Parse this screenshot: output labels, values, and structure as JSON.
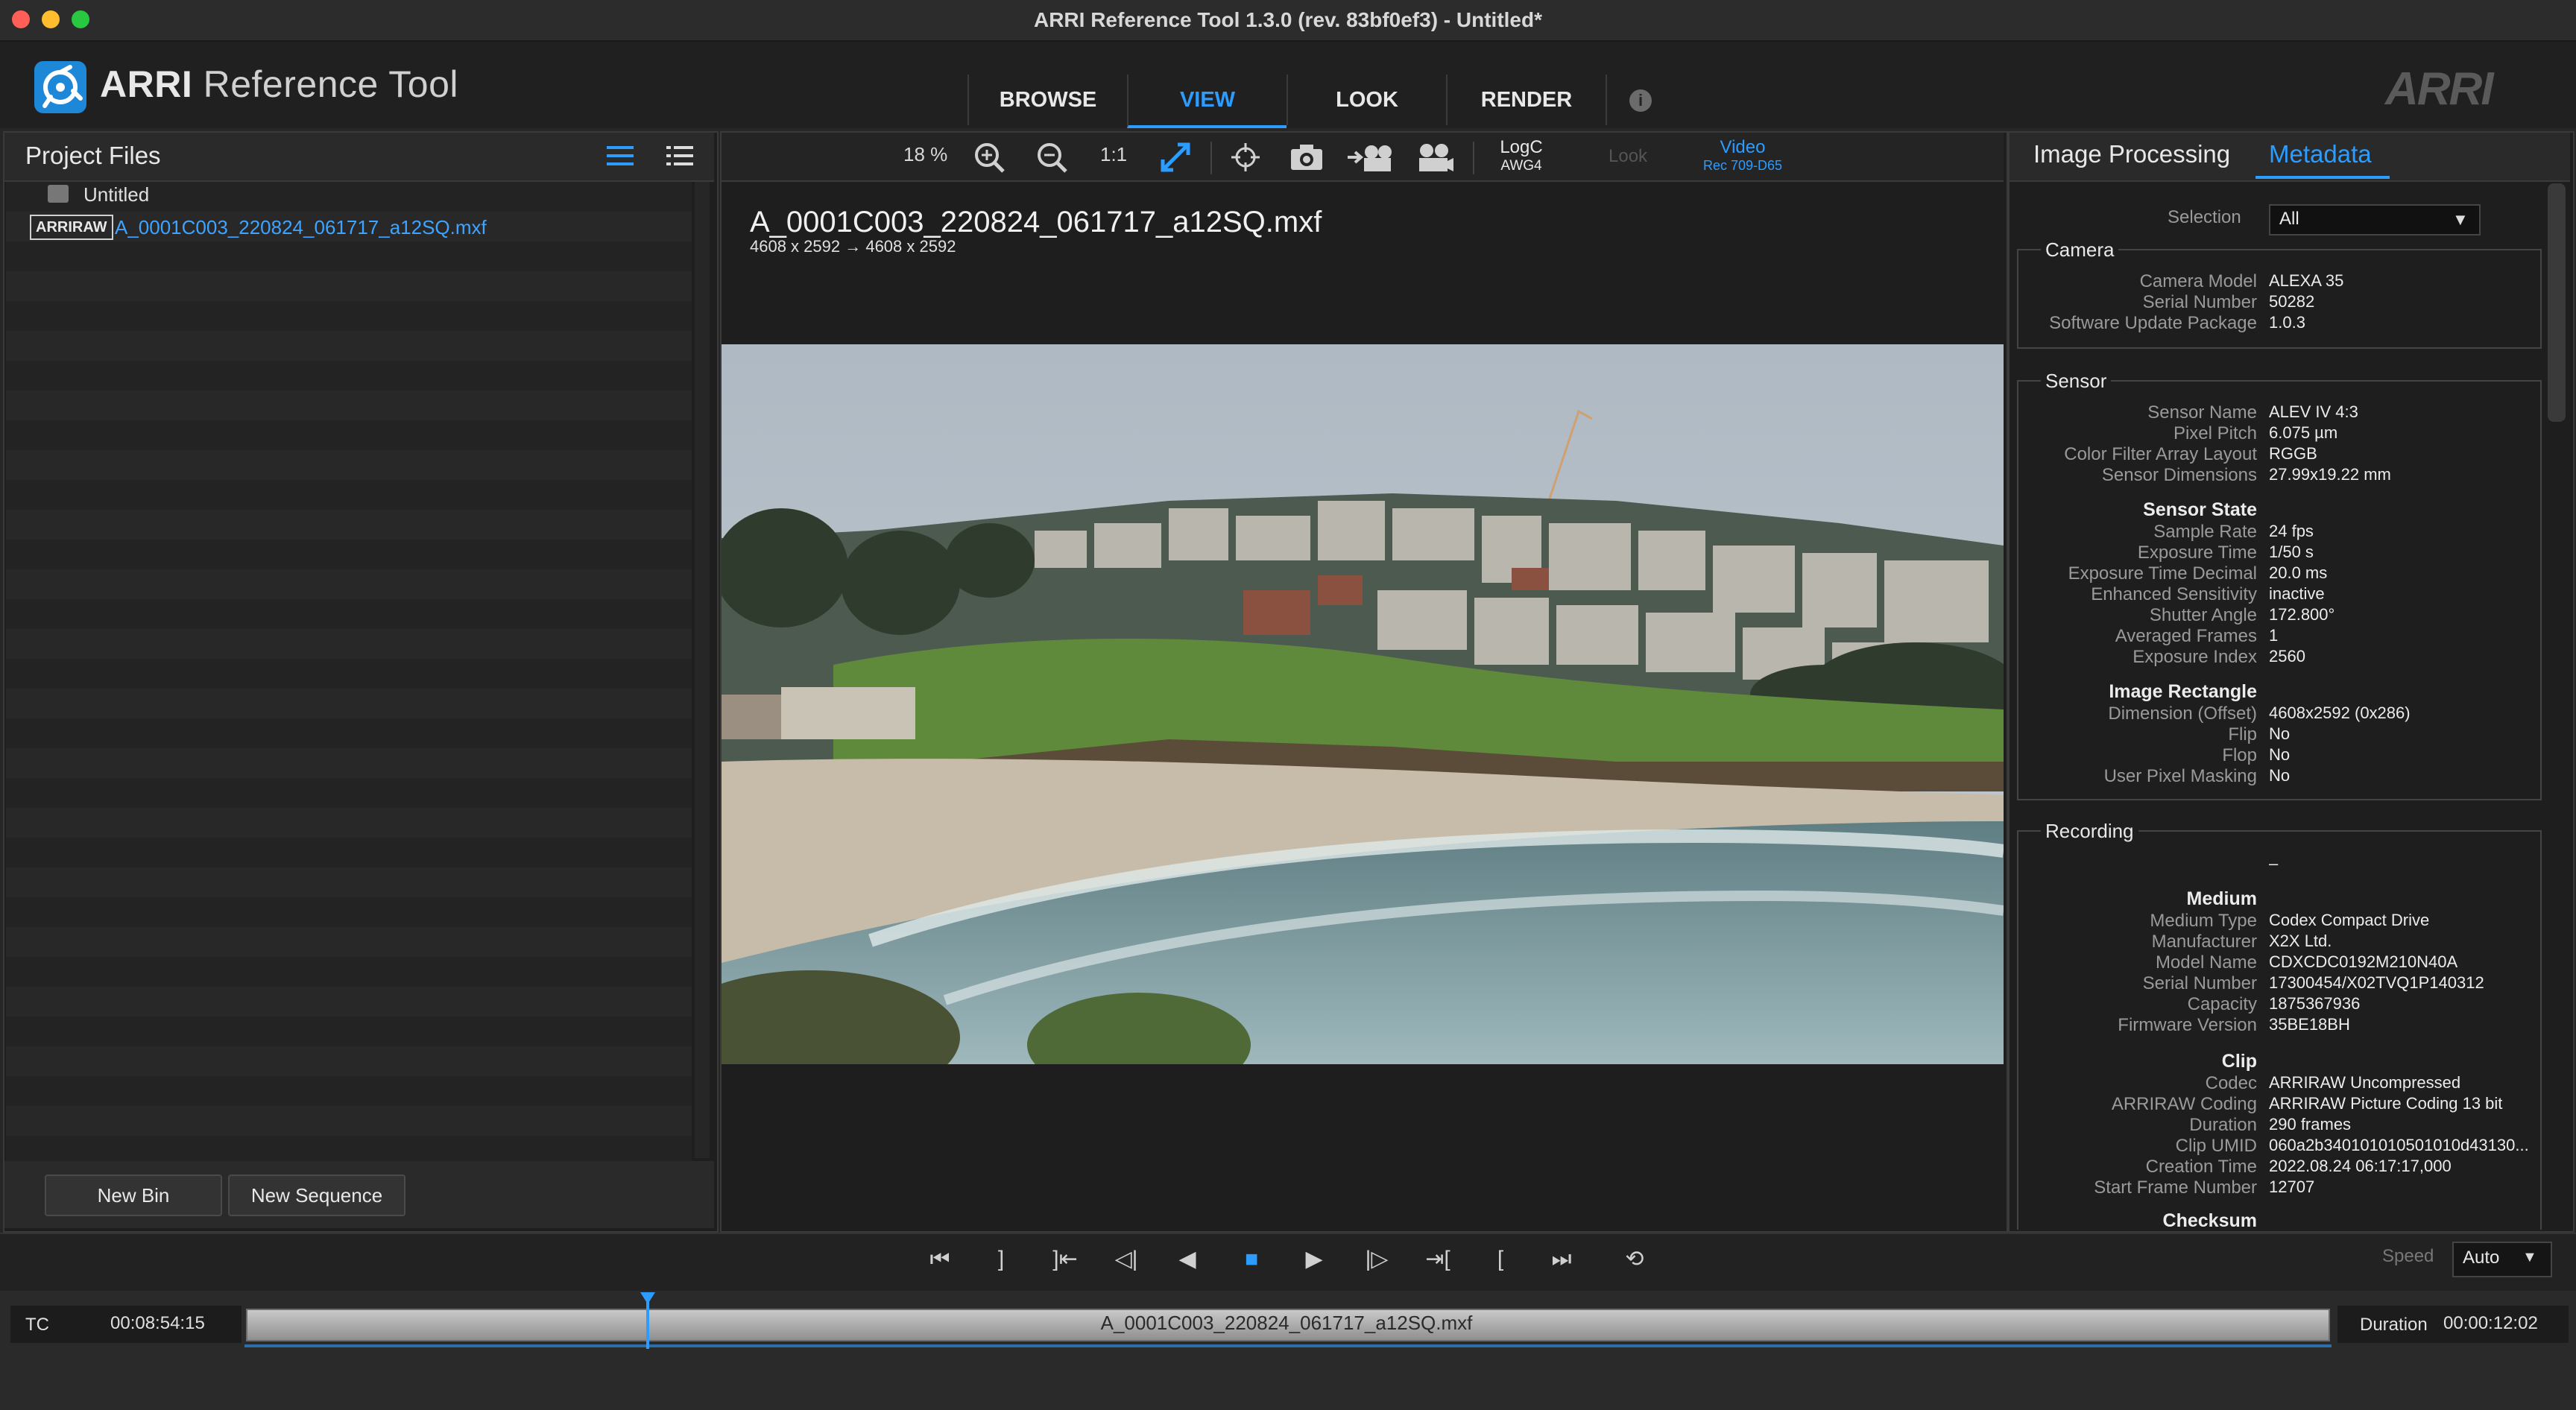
{
  "window": {
    "title": "ARRI Reference Tool 1.3.0 (rev. 83bf0ef3) - Untitled*",
    "traffic_lights": [
      "close",
      "minimize",
      "zoom"
    ]
  },
  "header": {
    "app_name_strong": "ARRI",
    "app_name_light": "Reference Tool",
    "tabs": [
      {
        "label": "BROWSE",
        "active": false
      },
      {
        "label": "VIEW",
        "active": true
      },
      {
        "label": "LOOK",
        "active": false
      },
      {
        "label": "RENDER",
        "active": false
      }
    ],
    "info_icon": "i",
    "brand": "ARRI"
  },
  "project_files": {
    "title": "Project Files",
    "view_icons": [
      "list-view-icon",
      "detail-list-icon"
    ],
    "items": [
      {
        "label": "Untitled",
        "icon": "bin-icon"
      },
      {
        "badge": "ARRIRAW",
        "label": "A_0001C003_220824_061717_a12SQ.mxf"
      }
    ],
    "buttons": {
      "new_bin": "New Bin",
      "new_sequence": "New Sequence"
    }
  },
  "viewer": {
    "zoom": "18 %",
    "one_to_one": "1:1",
    "input_color": {
      "top": "LogC",
      "bottom": "AWG4"
    },
    "look": "Look",
    "output": {
      "top": "Video",
      "bottom": "Rec 709-D65"
    },
    "clip_name": "A_0001C003_220824_061717_a12SQ.mxf",
    "clip_dims": "4608 x 2592  → 4608 x 2592"
  },
  "metadata_panel": {
    "tabs": [
      {
        "label": "Image Processing",
        "active": false
      },
      {
        "label": "Metadata",
        "active": true
      }
    ],
    "selection_label": "Selection",
    "selection_value": "All",
    "camera": {
      "title": "Camera",
      "rows": [
        {
          "k": "Camera Model",
          "v": "ALEXA 35"
        },
        {
          "k": "Serial Number",
          "v": "50282"
        },
        {
          "k": "Software Update Package",
          "v": "1.0.3"
        }
      ]
    },
    "sensor": {
      "title": "Sensor",
      "rows": [
        {
          "k": "Sensor Name",
          "v": "ALEV IV 4:3"
        },
        {
          "k": "Pixel Pitch",
          "v": "6.075 µm"
        },
        {
          "k": "Color Filter Array Layout",
          "v": "RGGB"
        },
        {
          "k": "Sensor Dimensions",
          "v": "27.99x19.22 mm"
        }
      ],
      "state_title": "Sensor State",
      "state_rows": [
        {
          "k": "Sample Rate",
          "v": "24 fps"
        },
        {
          "k": "Exposure Time",
          "v": "1/50 s"
        },
        {
          "k": "Exposure Time Decimal",
          "v": "20.0 ms"
        },
        {
          "k": "Enhanced Sensitivity",
          "v": "inactive"
        },
        {
          "k": "Shutter Angle",
          "v": "172.800°"
        },
        {
          "k": "Averaged Frames",
          "v": "1"
        },
        {
          "k": "Exposure Index",
          "v": "2560"
        }
      ],
      "rect_title": "Image Rectangle",
      "rect_rows": [
        {
          "k": "Dimension (Offset)",
          "v": "4608x2592 (0x286)"
        },
        {
          "k": "Flip",
          "v": "No"
        },
        {
          "k": "Flop",
          "v": "No"
        },
        {
          "k": "User Pixel Masking",
          "v": "No"
        }
      ]
    },
    "recording": {
      "title": "Recording",
      "dash": "–",
      "medium_title": "Medium",
      "medium_rows": [
        {
          "k": "Medium Type",
          "v": "Codex Compact Drive"
        },
        {
          "k": "Manufacturer",
          "v": "X2X Ltd."
        },
        {
          "k": "Model Name",
          "v": "CDXCDC0192M210N40A"
        },
        {
          "k": "Serial Number",
          "v": "17300454/X02TVQ1P140312"
        },
        {
          "k": "Capacity",
          "v": "1875367936"
        },
        {
          "k": "Firmware Version",
          "v": "35BE18BH"
        }
      ],
      "clip_title": "Clip",
      "clip_rows": [
        {
          "k": "Codec",
          "v": "ARRIRAW Uncompressed"
        },
        {
          "k": "ARRIRAW Coding",
          "v": "ARRIRAW Picture Coding 13 bit"
        },
        {
          "k": "Duration",
          "v": "290 frames"
        },
        {
          "k": "Clip UMID",
          "v": "060a2b340101010501010d43130..."
        },
        {
          "k": "Creation Time",
          "v": "2022.08.24 06:17:17,000"
        },
        {
          "k": "Start Frame Number",
          "v": "12707"
        }
      ],
      "checksum_title": "Checksum"
    }
  },
  "transport": {
    "speed_label": "Speed",
    "speed_value": "Auto",
    "buttons": [
      "go-to-start",
      "mark-out",
      "go-to-in",
      "step-back",
      "play-reverse",
      "stop",
      "play",
      "step-forward",
      "go-to-out",
      "mark-in",
      "go-to-end",
      "loop"
    ]
  },
  "timeline": {
    "tc_label": "TC",
    "tc_value": "00:08:54:15",
    "clip_label": "A_0001C003_220824_061717_a12SQ.mxf",
    "playhead_fraction": 0.193,
    "duration_label": "Duration",
    "duration_value": "00:00:12:02"
  },
  "colors": {
    "accent": "#2d9cff",
    "bg": "#262626",
    "panel": "#1e1e1e"
  }
}
